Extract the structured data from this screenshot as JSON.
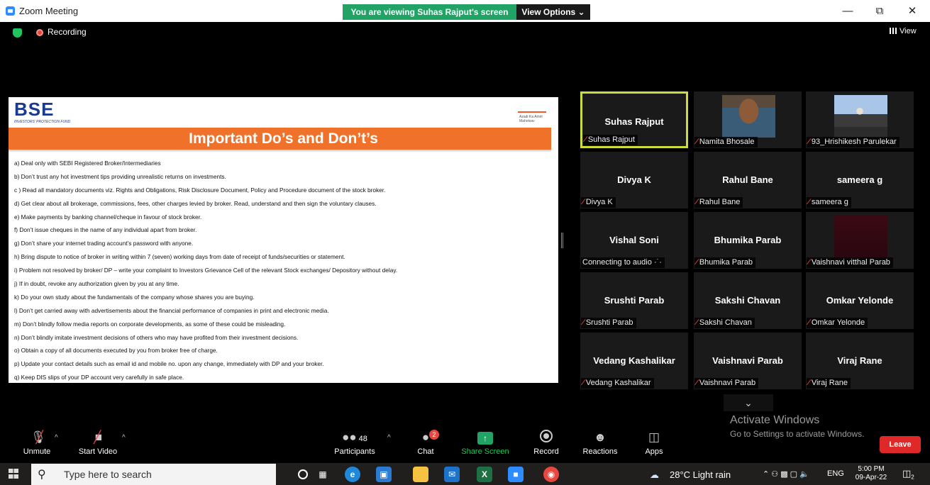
{
  "window": {
    "title": "Zoom Meeting",
    "banner": "You are viewing Suhas Rajput's screen",
    "view_options": "View Options ⌄",
    "minimize": "—",
    "maximize": "⧉",
    "close": "✕"
  },
  "top": {
    "recording": "Recording",
    "view": "View"
  },
  "slide": {
    "logo": "BSE",
    "logo_sub": "INVESTORS' PROTECTION FUND",
    "azadi": "Azadi Ka Amrit Mahotsav",
    "title": "Important Do’s and Don’t’s",
    "items": [
      "a) Deal only with SEBI Registered Broker/Intermediaries",
      "b) Don’t trust any hot investment tips providing unrealistic returns on investments.",
      "c ) Read all mandatory documents viz. Rights and Obligations, Risk Disclosure Document, Policy and Procedure document of the stock broker.",
      "d) Get clear about all brokerage, commissions, fees, other charges levied by broker.  Read, understand and then sign the voluntary clauses.",
      "e) Make payments by banking channel/cheque in favour of stock broker.",
      "f) Don’t issue cheques in the name of any individual apart from broker.",
      "g) Don’t share your internet trading account’s password with anyone.",
      "h) Bring dispute to notice of broker in writing within 7 (seven) working days from date of receipt of funds/securities or statement.",
      "i) Problem not resolved by broker/ DP – write your complaint to Investors Grievance Cell of the relevant Stock exchanges/ Depository without delay.",
      "j) If in doubt, revoke any authorization given by you at any time.",
      "k) Do your own study about the fundamentals of the company whose shares you are buying.",
      "l) Don’t get carried away with advertisements about the financial performance of companies in print and electronic media.",
      "m) Don’t blindly follow media reports on corporate developments, as some of these could be misleading.",
      "n) Don’t blindly imitate investment decisions of others who may have profited from their investment decisions.",
      "o) Obtain a copy of all documents executed by you from broker free of charge.",
      "p) Update your contact details such as email id and mobile no. upon any change, immediately with DP and your broker.",
      "q) Keep DIS slips of your DP account very carefully in safe place."
    ]
  },
  "participants": [
    {
      "name": "Suhas Rajput",
      "label": "Suhas Rajput",
      "muted": true
    },
    {
      "name": "",
      "label": "Namita Bhosale",
      "muted": true
    },
    {
      "name": "",
      "label": "93_Hrishikesh Parulekar",
      "muted": true
    },
    {
      "name": "Divya K",
      "label": "Divya K",
      "muted": true
    },
    {
      "name": "Rahul Bane",
      "label": "Rahul Bane",
      "muted": true
    },
    {
      "name": "sameera g",
      "label": "sameera g",
      "muted": true
    },
    {
      "name": "Vishal Soni",
      "label": "Connecting to audio ·˙·",
      "muted": false
    },
    {
      "name": "Bhumika Parab",
      "label": "Bhumika Parab",
      "muted": true
    },
    {
      "name": "",
      "label": "Vaishnavi vitthal Parab",
      "muted": true
    },
    {
      "name": "Srushti Parab",
      "label": "Srushti Parab",
      "muted": true
    },
    {
      "name": "Sakshi Chavan",
      "label": "Sakshi Chavan",
      "muted": true
    },
    {
      "name": "Omkar Yelonde",
      "label": "Omkar Yelonde",
      "muted": true
    },
    {
      "name": "Vedang  Kashalikar",
      "label": "Vedang Kashalikar",
      "muted": true
    },
    {
      "name": "Vaishnavi Parab",
      "label": "Vaishnavi Parab",
      "muted": true
    },
    {
      "name": "Viraj Rane",
      "label": "Viraj Rane",
      "muted": true
    }
  ],
  "watermark": {
    "line1": "Activate Windows",
    "line2": "Go to Settings to activate Windows."
  },
  "toolbar": {
    "unmute": "Unmute",
    "start_video": "Start Video",
    "participants": "Participants",
    "participant_count": "48",
    "chat": "Chat",
    "chat_badge": "2",
    "share": "Share Screen",
    "record": "Record",
    "reactions": "Reactions",
    "apps": "Apps",
    "leave": "Leave"
  },
  "taskbar": {
    "search_placeholder": "Type here to search",
    "weather": "28°C  Light rain",
    "lang": "ENG",
    "time": "5:00 PM",
    "date": "09-Apr-22",
    "notif": "2"
  }
}
